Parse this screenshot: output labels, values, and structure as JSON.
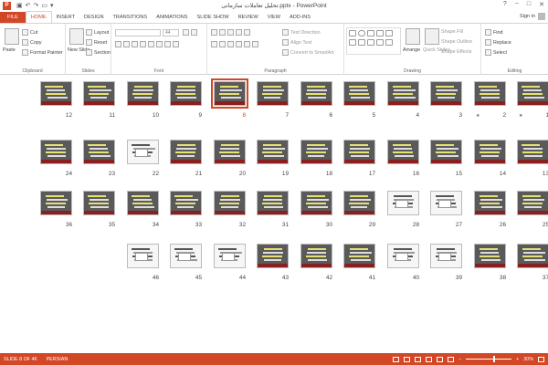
{
  "titlebar": {
    "app_badge": "P",
    "doc_title": "تحلیل تعاملات سازمانی.pptx - PowerPoint",
    "help_icon": "?",
    "min_icon": "−",
    "max_icon": "□",
    "close_icon": "✕"
  },
  "tabs": [
    "FILE",
    "HOME",
    "INSERT",
    "DESIGN",
    "TRANSITIONS",
    "ANIMATIONS",
    "SLIDE SHOW",
    "REVIEW",
    "VIEW",
    "ADD-INS"
  ],
  "active_tab": "HOME",
  "signin": "Sign in",
  "ribbon": {
    "clipboard": {
      "paste": "Paste",
      "cut": "Cut",
      "copy": "Copy",
      "format_painter": "Format Painter",
      "name": "Clipboard"
    },
    "slides": {
      "new_slide": "New Slide",
      "layout": "Layout",
      "reset": "Reset",
      "section": "Section",
      "name": "Slides"
    },
    "font": {
      "font_name": "",
      "font_size": "44",
      "name": "Font"
    },
    "paragraph": {
      "text_direction": "Text Direction",
      "align_text": "Align Text",
      "convert_smartart": "Convert to SmartArt",
      "name": "Paragraph"
    },
    "drawing": {
      "arrange": "Arrange",
      "quick_styles": "Quick Styles",
      "shape_fill": "Shape Fill",
      "shape_outline": "Shape Outline",
      "shape_effects": "Shape Effects",
      "name": "Drawing"
    },
    "editing": {
      "find": "Find",
      "replace": "Replace",
      "select": "Select",
      "name": "Editing"
    }
  },
  "slides": {
    "selected": 8,
    "starred": [
      1,
      2
    ],
    "light_slides": [
      22,
      27,
      28,
      39,
      40,
      44,
      45,
      46
    ],
    "items": [
      "1",
      "2",
      "3",
      "4",
      "5",
      "6",
      "7",
      "8",
      "9",
      "10",
      "11",
      "12",
      "13",
      "14",
      "15",
      "16",
      "17",
      "18",
      "19",
      "20",
      "21",
      "22",
      "23",
      "24",
      "25",
      "26",
      "27",
      "28",
      "29",
      "30",
      "31",
      "32",
      "33",
      "34",
      "35",
      "36",
      "37",
      "38",
      "39",
      "40",
      "41",
      "42",
      "43",
      "44",
      "45",
      "46"
    ],
    "star_glyph": "★"
  },
  "status": {
    "slide_of": "SLIDE 8 OF 46",
    "language": "PERSIAN",
    "zoom_out": "−",
    "zoom_in": "+",
    "zoom": "30%",
    "zoom_fraction": 0.62
  },
  "colors": {
    "accent": "#d24726",
    "slide_dark": "#5a5a5a",
    "slide_band": "#8a1f1f"
  }
}
